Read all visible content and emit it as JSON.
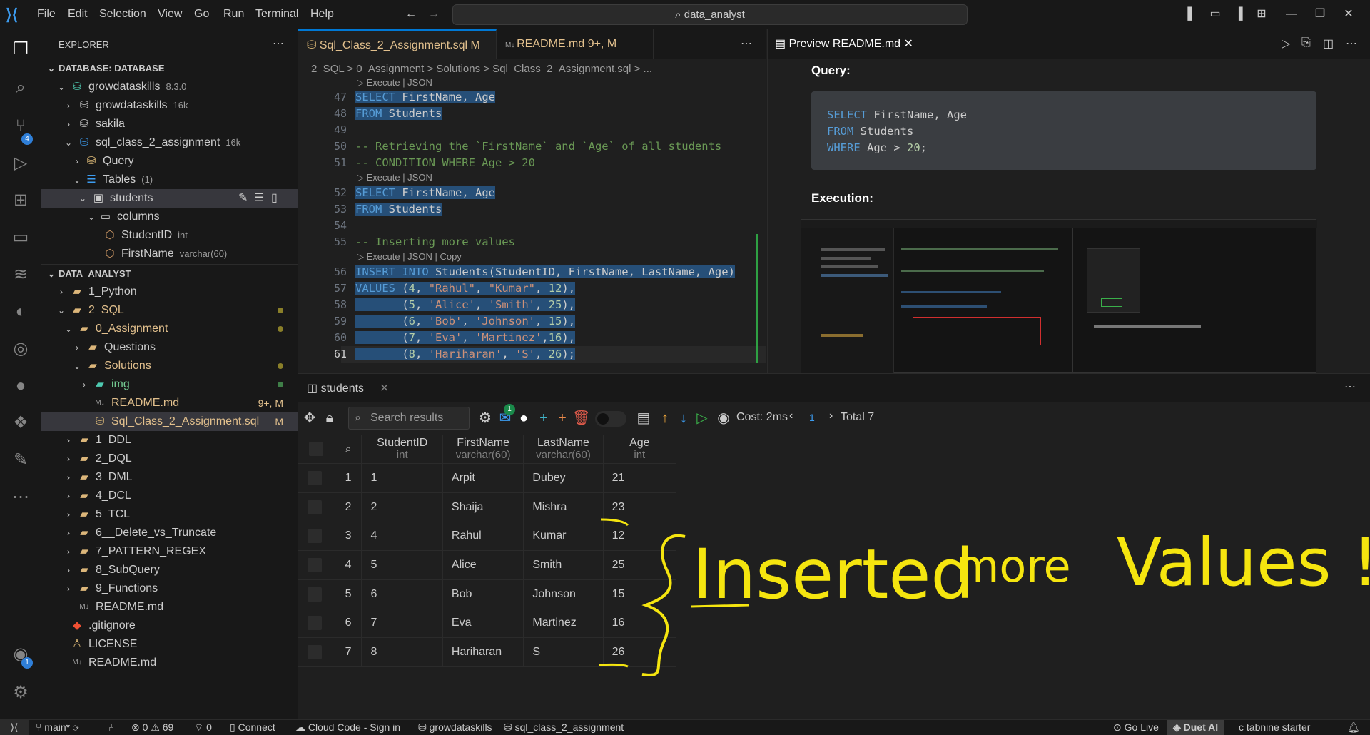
{
  "menu": [
    "File",
    "Edit",
    "Selection",
    "View",
    "Go",
    "Run",
    "Terminal",
    "Help"
  ],
  "command_center": "data_analyst",
  "explorer": {
    "title": "EXPLORER",
    "database_section": "DATABASE: DATABASE",
    "db_rows": [
      {
        "label": "growdataskills",
        "meta": "8.3.0"
      },
      {
        "label": "growdataskills",
        "meta": "16k"
      },
      {
        "label": "sakila",
        "meta": ""
      },
      {
        "label": "sql_class_2_assignment",
        "meta": "16k"
      },
      {
        "label": "Query",
        "meta": ""
      },
      {
        "label": "Tables",
        "meta": "(1)"
      },
      {
        "label": "students",
        "meta": ""
      },
      {
        "label": "columns",
        "meta": ""
      },
      {
        "label": "StudentID",
        "meta": "int"
      },
      {
        "label": "FirstName",
        "meta": "varchar(60)"
      }
    ],
    "project_section": "DATA_ANALYST",
    "files": [
      {
        "label": "1_Python",
        "meta": ""
      },
      {
        "label": "2_SQL",
        "meta": ""
      },
      {
        "label": "0_Assignment",
        "meta": ""
      },
      {
        "label": "Questions",
        "meta": ""
      },
      {
        "label": "Solutions",
        "meta": ""
      },
      {
        "label": "img",
        "meta": ""
      },
      {
        "label": "README.md",
        "meta": "9+, M"
      },
      {
        "label": "Sql_Class_2_Assignment.sql",
        "meta": "M"
      },
      {
        "label": "1_DDL",
        "meta": ""
      },
      {
        "label": "2_DQL",
        "meta": ""
      },
      {
        "label": "3_DML",
        "meta": ""
      },
      {
        "label": "4_DCL",
        "meta": ""
      },
      {
        "label": "5_TCL",
        "meta": ""
      },
      {
        "label": "6__Delete_vs_Truncate",
        "meta": ""
      },
      {
        "label": "7_PATTERN_REGEX",
        "meta": ""
      },
      {
        "label": "8_SubQuery",
        "meta": ""
      },
      {
        "label": "9_Functions",
        "meta": ""
      },
      {
        "label": "README.md",
        "meta": ""
      },
      {
        "label": ".gitignore",
        "meta": ""
      },
      {
        "label": "LICENSE",
        "meta": ""
      },
      {
        "label": "README.md",
        "meta": ""
      }
    ]
  },
  "editor": {
    "tabs": [
      {
        "label": "Sql_Class_2_Assignment.sql",
        "badge": "M"
      },
      {
        "label": "README.md",
        "badge": "9+, M"
      }
    ],
    "breadcrumb": "2_SQL  >  0_Assignment  >  Solutions  >  Sql_Class_2_Assignment.sql  >  ...",
    "lens_execute": "Execute | JSON",
    "lens_execute_copy": "Execute | JSON | Copy",
    "line_numbers": [
      "47",
      "48",
      "49",
      "50",
      "51",
      "52",
      "53",
      "54",
      "55",
      "56",
      "57",
      "58",
      "59",
      "60",
      "61"
    ]
  },
  "preview": {
    "tab_label": "Preview README.md",
    "query_heading": "Query:",
    "query_lines": [
      "SELECT FirstName, Age",
      "FROM Students",
      "WHERE Age > 20;"
    ],
    "execution_heading": "Execution:"
  },
  "results": {
    "tab_label": "students",
    "search_placeholder": "Search results",
    "notif_count": "1",
    "cost": "Cost: 2ms",
    "page": "1",
    "total": "Total 7",
    "columns": [
      {
        "name": "StudentID",
        "type": "int"
      },
      {
        "name": "FirstName",
        "type": "varchar(60)"
      },
      {
        "name": "LastName",
        "type": "varchar(60)"
      },
      {
        "name": "Age",
        "type": "int"
      }
    ],
    "rows": [
      [
        "1",
        "1",
        "Arpit",
        "Dubey",
        "21"
      ],
      [
        "2",
        "2",
        "Shaija",
        "Mishra",
        "23"
      ],
      [
        "3",
        "4",
        "Rahul",
        "Kumar",
        "12"
      ],
      [
        "4",
        "5",
        "Alice",
        "Smith",
        "25"
      ],
      [
        "5",
        "6",
        "Bob",
        "Johnson",
        "15"
      ],
      [
        "6",
        "7",
        "Eva",
        "Martinez",
        "16"
      ],
      [
        "7",
        "8",
        "Hariharan",
        "S",
        "26"
      ]
    ]
  },
  "annotation": {
    "text_inserted": "Inserted",
    "text_more": "more",
    "text_values": "Values !!",
    "color": "#f5e50f"
  },
  "status": {
    "branch": "main*",
    "errors": "0",
    "warnings": "69",
    "ports": "0",
    "connect": "Connect",
    "cloud": "Cloud Code - Sign in",
    "db1": "growdataskills",
    "db2": "sql_class_2_assignment",
    "golive": "Go Live",
    "duet": "Duet AI",
    "tabnine": "tabnine starter"
  },
  "accounts_badge": "1",
  "scm_badge": "4"
}
